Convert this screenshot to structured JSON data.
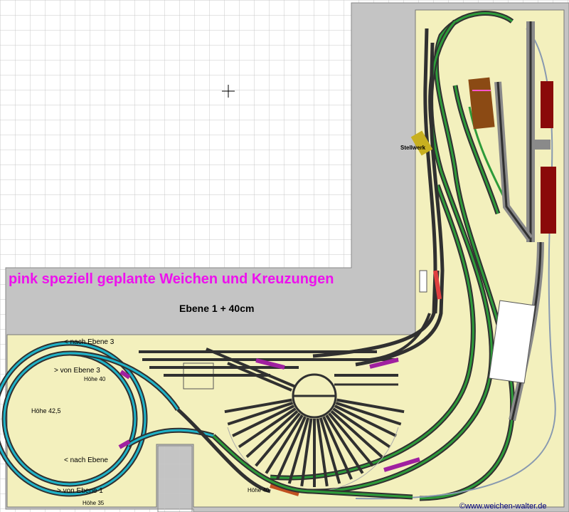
{
  "title": "pink speziell geplante Weichen und Kreuzungen",
  "level_label": "Ebene 1 + 40cm",
  "labels": {
    "stellwerk": "Stellwerk",
    "nach_ebene3": "< nach Ebene 3",
    "von_ebene3": "> von Ebene 3",
    "hoehe40_a": "Höhe 40",
    "hoehe425": "Höhe 42,5",
    "nach_ebene_x": "< nach Ebene",
    "von_ebene1": "> von Ebene 1",
    "hoehe35": "Höhe 35",
    "hoehe40_b": "Höhe 40"
  },
  "watermark": "©www.weichen-walter.de",
  "colors": {
    "grid_bg": "#ffffff",
    "grid_line": "#c8c8c8",
    "wall": "#c4c4c4",
    "baseboard": "#f3f0bd",
    "track_green": "#2e9b3a",
    "track_cyan": "#1fb3c8",
    "track_dark": "#303030",
    "special_pink": "#a020a0",
    "title_magenta": "#ee10ee",
    "building_red": "#8a0a0a",
    "building_brown": "#8b4a14"
  }
}
